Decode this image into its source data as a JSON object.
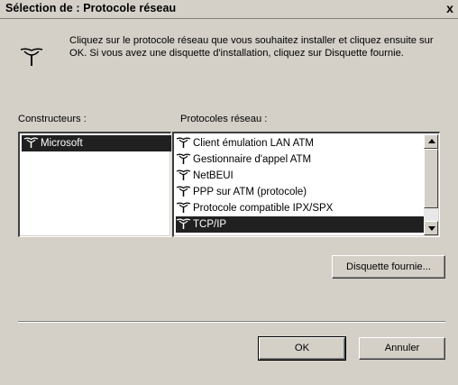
{
  "window": {
    "title": "Sélection de : Protocole réseau",
    "close_label": "x"
  },
  "intro": {
    "text": "Cliquez sur le protocole réseau que vous souhaitez installer et cliquez ensuite sur OK. Si vous avez une disquette d'installation, cliquez sur Disquette fournie."
  },
  "manufacturers": {
    "label": "Constructeurs :",
    "items": [
      {
        "label": "Microsoft",
        "icon": "network-protocol-icon",
        "selected": true
      }
    ]
  },
  "protocols": {
    "label": "Protocoles réseau :",
    "items": [
      {
        "label": "Client émulation LAN ATM",
        "icon": "network-protocol-icon",
        "selected": false
      },
      {
        "label": "Gestionnaire d'appel ATM",
        "icon": "network-protocol-icon",
        "selected": false
      },
      {
        "label": "NetBEUI",
        "icon": "network-protocol-icon",
        "selected": false
      },
      {
        "label": "PPP sur ATM (protocole)",
        "icon": "network-protocol-icon",
        "selected": false
      },
      {
        "label": "Protocole compatible IPX/SPX",
        "icon": "network-protocol-icon",
        "selected": false
      },
      {
        "label": "TCP/IP",
        "icon": "network-protocol-icon",
        "selected": true
      }
    ]
  },
  "buttons": {
    "have_disk": "Disquette fournie...",
    "ok": "OK",
    "cancel": "Annuler"
  },
  "colors": {
    "dialog_bg": "#d4d0c8",
    "selection": "#000080"
  }
}
